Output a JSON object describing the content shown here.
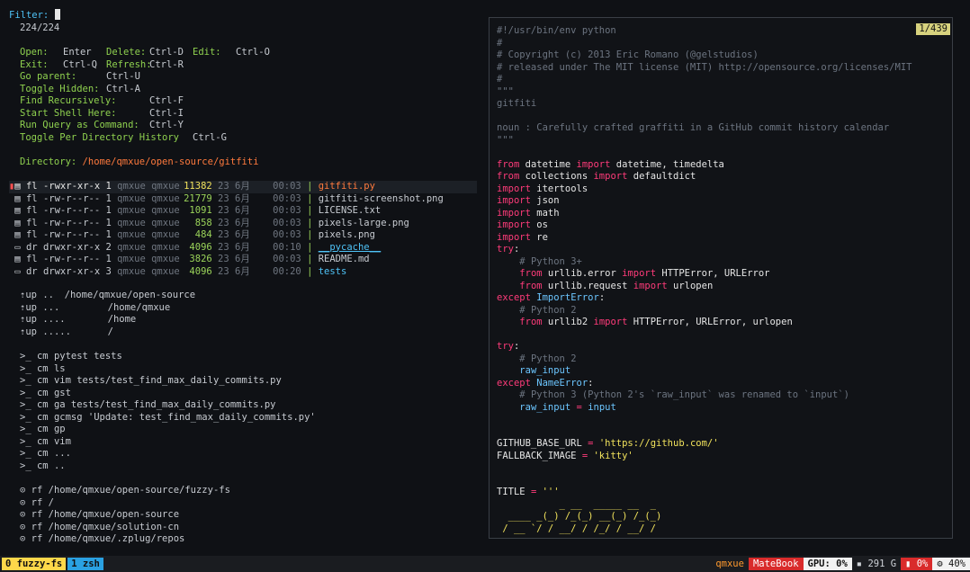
{
  "filter": {
    "label": "Filter:",
    "count": "224/224"
  },
  "help": [
    [
      "Open:",
      "Enter",
      "Delete:",
      "Ctrl-D",
      "Edit:",
      "Ctrl-O"
    ],
    [
      "Exit:",
      "Ctrl-Q",
      "Refresh:",
      "Ctrl-R",
      "",
      ""
    ],
    [
      "Go parent:",
      "Ctrl-U",
      "",
      "",
      "",
      ""
    ],
    [
      "Toggle Hidden:",
      "Ctrl-A",
      "",
      "",
      "",
      ""
    ],
    [
      "Find Recursively:",
      "Ctrl-F",
      "",
      "",
      "",
      ""
    ],
    [
      "Start Shell Here:",
      "Ctrl-I",
      "",
      "",
      "",
      ""
    ],
    [
      "Run Query as Command:",
      "Ctrl-Y",
      "",
      "",
      "",
      ""
    ],
    [
      "Toggle Per Directory History",
      "Ctrl-G",
      "",
      "",
      "",
      ""
    ]
  ],
  "directory": {
    "label": "Directory:",
    "path": "/home/qmxue/open-source/gitfiti"
  },
  "files": [
    {
      "kind": "fl",
      "perm": "-rwxr-xr-x",
      "n": "1",
      "owner": "qmxue",
      "group": "qmxue",
      "size": "11382",
      "date": "23 6月",
      "time": "00:03",
      "name": "gitfiti.py",
      "style": "selected"
    },
    {
      "kind": "fl",
      "perm": "-rw-r--r--",
      "n": "1",
      "owner": "qmxue",
      "group": "qmxue",
      "size": "21779",
      "date": "23 6月",
      "time": "00:03",
      "name": "gitfiti-screenshot.png",
      "style": "normal"
    },
    {
      "kind": "fl",
      "perm": "-rw-r--r--",
      "n": "1",
      "owner": "qmxue",
      "group": "qmxue",
      "size": "1091",
      "date": "23 6月",
      "time": "00:03",
      "name": "LICENSE.txt",
      "style": "normal"
    },
    {
      "kind": "fl",
      "perm": "-rw-r--r--",
      "n": "1",
      "owner": "qmxue",
      "group": "qmxue",
      "size": "858",
      "date": "23 6月",
      "time": "00:03",
      "name": "pixels-large.png",
      "style": "normal"
    },
    {
      "kind": "fl",
      "perm": "-rw-r--r--",
      "n": "1",
      "owner": "qmxue",
      "group": "qmxue",
      "size": "484",
      "date": "23 6月",
      "time": "00:03",
      "name": "pixels.png",
      "style": "normal"
    },
    {
      "kind": "dr",
      "perm": "drwxr-xr-x",
      "n": "2",
      "owner": "qmxue",
      "group": "qmxue",
      "size": "4096",
      "date": "23 6月",
      "time": "00:10",
      "name": "__pycache__",
      "style": "dir"
    },
    {
      "kind": "fl",
      "perm": "-rw-r--r--",
      "n": "1",
      "owner": "qmxue",
      "group": "qmxue",
      "size": "3826",
      "date": "23 6月",
      "time": "00:03",
      "name": "README.md",
      "style": "normal"
    },
    {
      "kind": "dr",
      "perm": "drwxr-xr-x",
      "n": "3",
      "owner": "qmxue",
      "group": "qmxue",
      "size": "4096",
      "date": "23 6月",
      "time": "00:20",
      "name": "tests",
      "style": "dir"
    }
  ],
  "up_entries": [
    {
      "tag": "up",
      "dots": "..",
      "path": "/home/qmxue/open-source"
    },
    {
      "tag": "up",
      "dots": "...",
      "path": "/home/qmxue"
    },
    {
      "tag": "up",
      "dots": "....",
      "path": "/home"
    },
    {
      "tag": "up",
      "dots": ".....",
      "path": "/"
    }
  ],
  "commands": [
    "cm pytest tests",
    "cm ls",
    "cm vim tests/test_find_max_daily_commits.py",
    "cm gst",
    "cm ga tests/test_find_max_daily_commits.py",
    "cm gcmsg 'Update: test_find_max_daily_commits.py'",
    "cm gp",
    "cm vim",
    "cm ...",
    "cm .."
  ],
  "recent": [
    "rf /home/qmxue/open-source/fuzzy-fs",
    "rf /",
    "rf /home/qmxue/open-source",
    "rf /home/qmxue/solution-cn",
    "rf /home/qmxue/.zplug/repos"
  ],
  "preview": {
    "counter": "1/439",
    "lines": [
      [
        [
          "cm",
          "#!/usr/bin/env python"
        ]
      ],
      [
        [
          "cm",
          "#"
        ]
      ],
      [
        [
          "cm",
          "# Copyright (c) 2013 Eric Romano (@gelstudios)"
        ]
      ],
      [
        [
          "cm",
          "# released under The MIT license (MIT) http://opensource.org/licenses/MIT"
        ]
      ],
      [
        [
          "cm",
          "#"
        ]
      ],
      [
        [
          "cm",
          "\"\"\""
        ]
      ],
      [
        [
          "cm",
          "gitfiti"
        ]
      ],
      [
        [
          "cm",
          ""
        ]
      ],
      [
        [
          "cm",
          "noun : Carefully crafted graffiti in a GitHub commit history calendar"
        ]
      ],
      [
        [
          "cm",
          "\"\"\""
        ]
      ],
      [
        [
          "pln",
          ""
        ]
      ],
      [
        [
          "kw",
          "from"
        ],
        [
          "pln",
          " datetime "
        ],
        [
          "kw",
          "import"
        ],
        [
          "pln",
          " datetime, timedelta"
        ]
      ],
      [
        [
          "kw",
          "from"
        ],
        [
          "pln",
          " collections "
        ],
        [
          "kw",
          "import"
        ],
        [
          "pln",
          " defaultdict"
        ]
      ],
      [
        [
          "kw",
          "import"
        ],
        [
          "pln",
          " itertools"
        ]
      ],
      [
        [
          "kw",
          "import"
        ],
        [
          "pln",
          " json"
        ]
      ],
      [
        [
          "kw",
          "import"
        ],
        [
          "pln",
          " math"
        ]
      ],
      [
        [
          "kw",
          "import"
        ],
        [
          "pln",
          " os"
        ]
      ],
      [
        [
          "kw",
          "import"
        ],
        [
          "pln",
          " re"
        ]
      ],
      [
        [
          "kw",
          "try"
        ],
        [
          "pln",
          ":"
        ]
      ],
      [
        [
          "pln",
          "    "
        ],
        [
          "cm",
          "# Python 3+"
        ]
      ],
      [
        [
          "pln",
          "    "
        ],
        [
          "kw",
          "from"
        ],
        [
          "pln",
          " urllib.error "
        ],
        [
          "kw",
          "import"
        ],
        [
          "pln",
          " HTTPError, URLError"
        ]
      ],
      [
        [
          "pln",
          "    "
        ],
        [
          "kw",
          "from"
        ],
        [
          "pln",
          " urllib.request "
        ],
        [
          "kw",
          "import"
        ],
        [
          "pln",
          " urlopen"
        ]
      ],
      [
        [
          "kw",
          "except"
        ],
        [
          "pln",
          " "
        ],
        [
          "fn",
          "ImportError"
        ],
        [
          "pln",
          ":"
        ]
      ],
      [
        [
          "pln",
          "    "
        ],
        [
          "cm",
          "# Python 2"
        ]
      ],
      [
        [
          "pln",
          "    "
        ],
        [
          "kw",
          "from"
        ],
        [
          "pln",
          " urllib2 "
        ],
        [
          "kw",
          "import"
        ],
        [
          "pln",
          " HTTPError, URLError, urlopen"
        ]
      ],
      [
        [
          "pln",
          ""
        ]
      ],
      [
        [
          "kw",
          "try"
        ],
        [
          "pln",
          ":"
        ]
      ],
      [
        [
          "pln",
          "    "
        ],
        [
          "cm",
          "# Python 2"
        ]
      ],
      [
        [
          "pln",
          "    "
        ],
        [
          "fn",
          "raw_input"
        ]
      ],
      [
        [
          "kw",
          "except"
        ],
        [
          "pln",
          " "
        ],
        [
          "fn",
          "NameError"
        ],
        [
          "pln",
          ":"
        ]
      ],
      [
        [
          "pln",
          "    "
        ],
        [
          "cm",
          "# Python 3 (Python 2's `raw_input` was renamed to `input`)"
        ]
      ],
      [
        [
          "pln",
          "    "
        ],
        [
          "fn",
          "raw_input"
        ],
        [
          "pln",
          " "
        ],
        [
          "kw",
          "="
        ],
        [
          "pln",
          " "
        ],
        [
          "fn",
          "input"
        ]
      ],
      [
        [
          "pln",
          ""
        ]
      ],
      [
        [
          "pln",
          ""
        ]
      ],
      [
        [
          "pln",
          "GITHUB_BASE_URL "
        ],
        [
          "kw",
          "="
        ],
        [
          "pln",
          " "
        ],
        [
          "st",
          "'https://github.com/'"
        ]
      ],
      [
        [
          "pln",
          "FALLBACK_IMAGE "
        ],
        [
          "kw",
          "="
        ],
        [
          "pln",
          " "
        ],
        [
          "st",
          "'kitty'"
        ]
      ],
      [
        [
          "pln",
          ""
        ]
      ],
      [
        [
          "pln",
          ""
        ]
      ],
      [
        [
          "pln",
          "TITLE "
        ],
        [
          "kw",
          "="
        ],
        [
          "pln",
          " "
        ],
        [
          "st",
          "'''"
        ]
      ],
      [
        [
          "st",
          "           _ __  _____ __  _"
        ]
      ],
      [
        [
          "st",
          "  ____ _(_) /_(_) __(_) /_(_)"
        ]
      ],
      [
        [
          "st",
          " / __ `/ / __/ / /_/ / __/ /"
        ]
      ]
    ]
  },
  "statusbar": {
    "tab1_num": "0",
    "tab1": "fuzzy-fs",
    "tab2_num": "1",
    "tab2": "zsh",
    "user": "qmxue",
    "host": "MateBook",
    "gpu": "GPU: 0%",
    "disk": "291 G",
    "mem": "0%",
    "cpu": "40%"
  }
}
